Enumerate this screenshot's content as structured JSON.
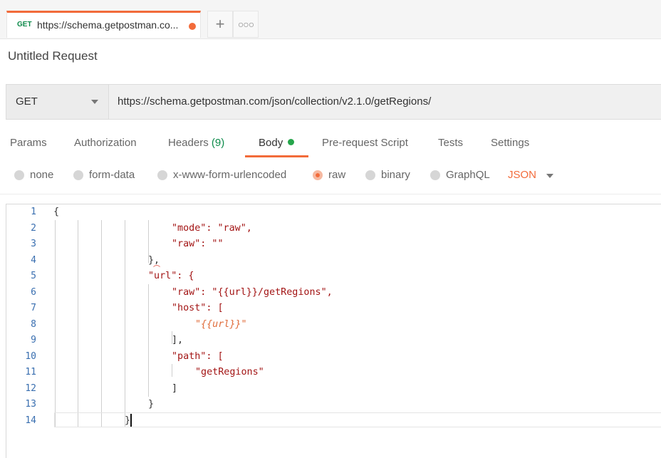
{
  "tab": {
    "method": "GET",
    "title": "https://schema.getpostman.co...",
    "add_icon": "plus-icon",
    "more_icon": "ellipsis-icon"
  },
  "request_title": "Untitled Request",
  "url_bar": {
    "method": "GET",
    "url": "https://schema.getpostman.com/json/collection/v2.1.0/getRegions/"
  },
  "request_tabs": [
    {
      "label": "Params"
    },
    {
      "label": "Authorization"
    },
    {
      "label": "Headers",
      "count": "(9)"
    },
    {
      "label": "Body",
      "active": true
    },
    {
      "label": "Pre-request Script"
    },
    {
      "label": "Tests"
    },
    {
      "label": "Settings"
    }
  ],
  "body_types": [
    {
      "label": "none",
      "selected": false
    },
    {
      "label": "form-data",
      "selected": false
    },
    {
      "label": "x-www-form-urlencoded",
      "selected": false
    },
    {
      "label": "raw",
      "selected": true
    },
    {
      "label": "binary",
      "selected": false
    },
    {
      "label": "GraphQL",
      "selected": false
    }
  ],
  "language": "JSON",
  "editor": {
    "line_numbers": [
      "1",
      "2",
      "3",
      "4",
      "5",
      "6",
      "7",
      "8",
      "9",
      "10",
      "11",
      "12",
      "13",
      "14"
    ],
    "lines": [
      "{",
      "\"mode\": \"raw\",",
      "\"raw\": \"\"",
      "},",
      "\"url\": {",
      "\"raw\": \"{{url}}/getRegions\",",
      "\"host\": [",
      "\"{{url}}\"",
      "],",
      "\"path\": [",
      "\"getRegions\"",
      "]",
      "}",
      "}"
    ]
  },
  "colors": {
    "accent": "#f26b3a",
    "get_method": "#0c8a4a",
    "body_dot": "#26a54b"
  }
}
